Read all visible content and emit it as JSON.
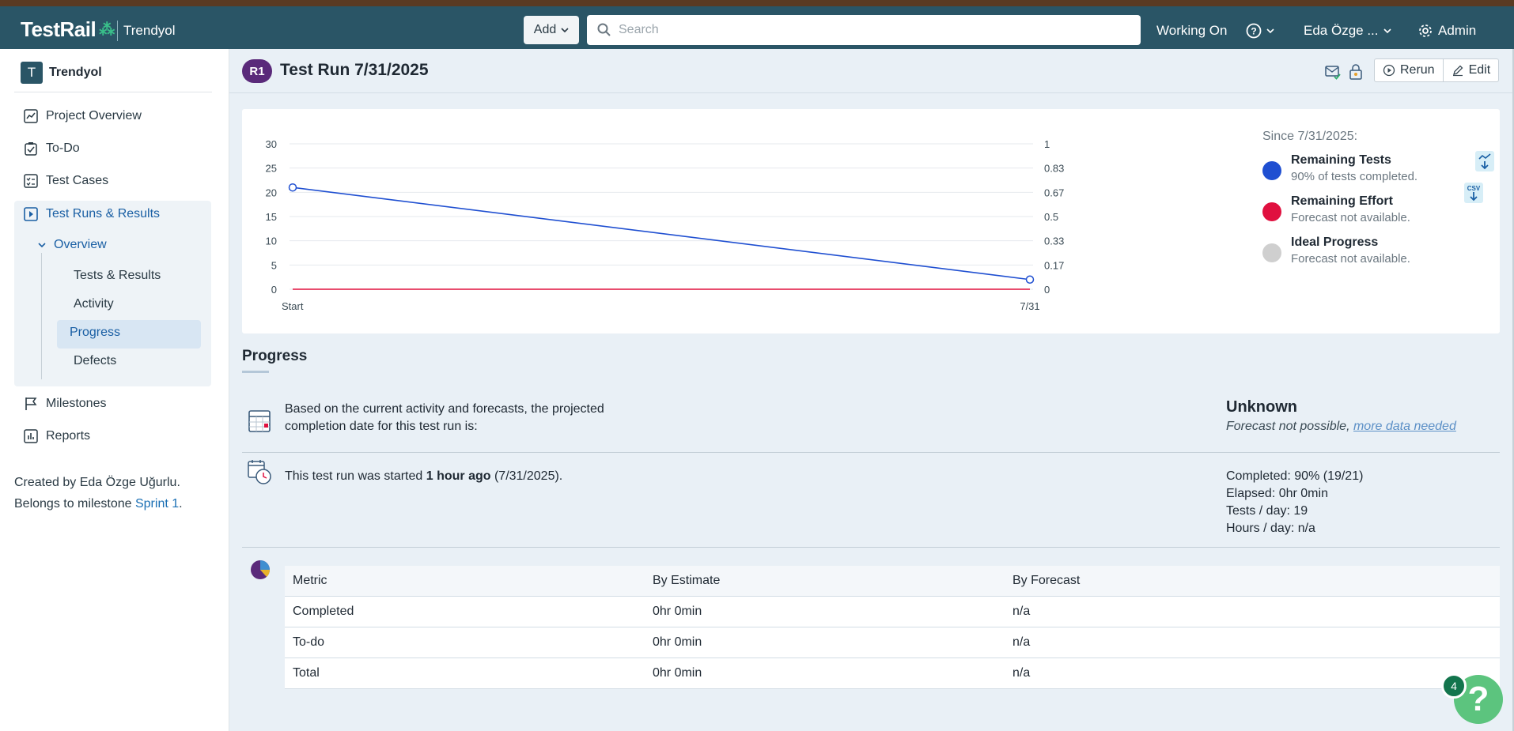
{
  "header": {
    "logo": "TestRail",
    "project": "Trendyol",
    "add_label": "Add",
    "search_placeholder": "Search",
    "working_on": "Working On",
    "user": "Eda Özge ...",
    "admin": "Admin",
    "brand_color": "#2a5566"
  },
  "sidebar": {
    "project_initial": "T",
    "project_name": "Trendyol",
    "items": [
      {
        "label": "Project Overview",
        "icon": "chart-line-icon"
      },
      {
        "label": "To-Do",
        "icon": "clipboard-check-icon"
      },
      {
        "label": "Test Cases",
        "icon": "checklist-icon"
      },
      {
        "label": "Test Runs & Results",
        "icon": "play-square-icon"
      },
      {
        "label": "Milestones",
        "icon": "flag-icon"
      },
      {
        "label": "Reports",
        "icon": "bar-chart-icon"
      }
    ],
    "overview_label": "Overview",
    "sub_items": [
      "Tests & Results",
      "Activity",
      "Progress",
      "Defects"
    ],
    "active_sub": "Progress",
    "created_by": "Created by Eda Özge Uğurlu.",
    "belongs_prefix": "Belongs to milestone ",
    "milestone": "Sprint 1",
    "belongs_suffix": "."
  },
  "page": {
    "badge": "R1",
    "title": "Test Run 7/31/2025",
    "rerun_label": "Rerun",
    "edit_label": "Edit"
  },
  "chart_data": {
    "type": "line",
    "x": [
      "Start",
      "7/31"
    ],
    "ylim": [
      0,
      30
    ],
    "y_ticks": [
      30,
      25,
      20,
      15,
      10,
      5,
      0
    ],
    "y2lim": [
      0,
      1
    ],
    "y2_ticks": [
      "1",
      "0.83",
      "0.67",
      "0.5",
      "0.33",
      "0.17",
      "0"
    ],
    "grid": true,
    "series": [
      {
        "name": "Remaining Tests",
        "color": "#1f4fd1",
        "values": [
          21,
          2
        ]
      },
      {
        "name": "Remaining Effort",
        "color": "#e0103f",
        "values": [
          0,
          0
        ]
      }
    ],
    "legend": {
      "since": "Since 7/31/2025:",
      "placement": "right",
      "entries": [
        {
          "name": "Remaining Tests",
          "desc": "90% of tests completed.",
          "color": "#1f4fd1"
        },
        {
          "name": "Remaining Effort",
          "desc": "Forecast not available.",
          "color": "#e0103f"
        },
        {
          "name": "Ideal Progress",
          "desc": "Forecast not available.",
          "color": "#cfcfcf"
        }
      ]
    }
  },
  "progress": {
    "title": "Progress",
    "projection_line1": "Based on the current activity and forecasts, the projected",
    "projection_line2": "completion date for this test run is:",
    "status": "Unknown",
    "forecast_text": "Forecast not possible, ",
    "forecast_link": "more data needed",
    "started_prefix": "This test run was started ",
    "started_bold": "1 hour ago",
    "started_suffix": " (7/31/2025).",
    "stats": [
      "Completed: 90% (19/21)",
      "Elapsed: 0hr 0min",
      "Tests / day: 19",
      "Hours / day: n/a"
    ]
  },
  "metrics": {
    "headers": [
      "Metric",
      "By Estimate",
      "By Forecast"
    ],
    "rows": [
      [
        "Completed",
        "0hr 0min",
        "n/a"
      ],
      [
        "To-do",
        "0hr 0min",
        "n/a"
      ],
      [
        "Total",
        "0hr 0min",
        "n/a"
      ]
    ]
  },
  "help": {
    "count": "4",
    "symbol": "?"
  }
}
